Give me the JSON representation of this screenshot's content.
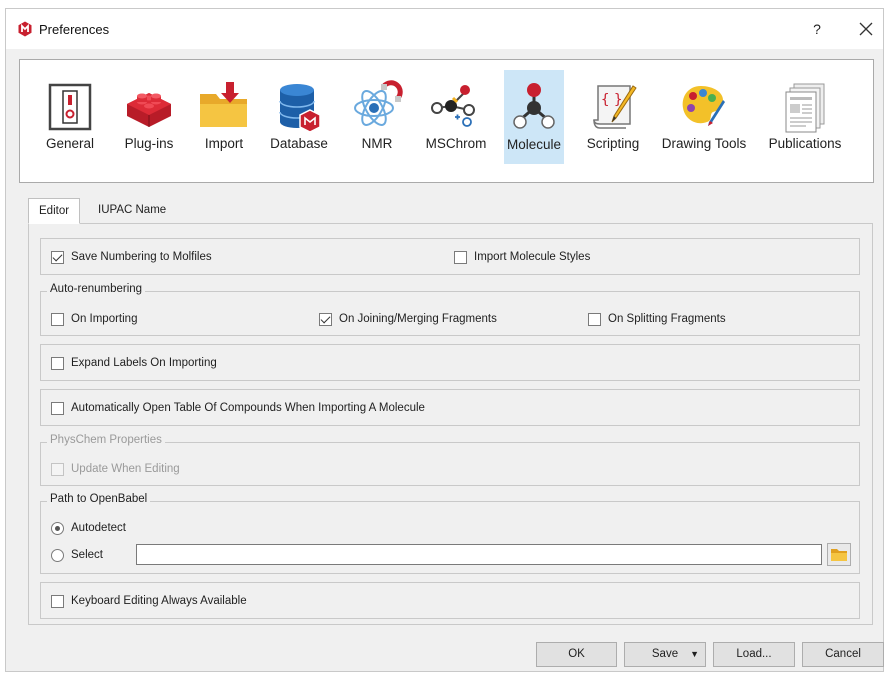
{
  "window": {
    "title": "Preferences",
    "help_label": "?"
  },
  "toolbar": {
    "items": [
      {
        "label": "General",
        "icon": "switch-icon"
      },
      {
        "label": "Plug-ins",
        "icon": "brick-icon"
      },
      {
        "label": "Import",
        "icon": "folder-import-icon"
      },
      {
        "label": "Database",
        "icon": "database-icon"
      },
      {
        "label": "NMR",
        "icon": "nmr-icon"
      },
      {
        "label": "MSChrom",
        "icon": "mschrom-icon"
      },
      {
        "label": "Molecule",
        "icon": "molecule-icon"
      },
      {
        "label": "Scripting",
        "icon": "script-icon"
      },
      {
        "label": "Drawing Tools",
        "icon": "palette-icon"
      },
      {
        "label": "Publications",
        "icon": "publications-icon"
      }
    ],
    "selected": "Molecule"
  },
  "tabs": [
    {
      "label": "Editor"
    },
    {
      "label": "IUPAC Name"
    }
  ],
  "editor": {
    "save_numbering": {
      "label": "Save Numbering to Molfiles",
      "checked": true
    },
    "import_styles": {
      "label": "Import Molecule Styles",
      "checked": false
    },
    "auto_renumbering": {
      "title": "Auto-renumbering",
      "on_importing": {
        "label": "On Importing",
        "checked": false
      },
      "on_joining": {
        "label": "On Joining/Merging Fragments",
        "checked": true
      },
      "on_splitting": {
        "label": "On Splitting Fragments",
        "checked": false
      }
    },
    "expand_labels": {
      "label": "Expand Labels On Importing",
      "checked": false
    },
    "auto_open_table": {
      "label": "Automatically Open Table Of Compounds When Importing A Molecule",
      "checked": false
    },
    "physchem": {
      "title": "PhysChem Properties",
      "update_when_editing": {
        "label": "Update When Editing",
        "checked": false
      }
    },
    "openbabel": {
      "title": "Path to OpenBabel",
      "autodetect": {
        "label": "Autodetect",
        "selected": true
      },
      "select": {
        "label": "Select",
        "selected": false
      },
      "path_value": ""
    },
    "keyboard_editing": {
      "label": "Keyboard Editing Always Available",
      "checked": false
    }
  },
  "buttons": {
    "ok": "OK",
    "save": "Save",
    "load": "Load...",
    "cancel": "Cancel"
  },
  "colors": {
    "selection": "#cde6f7",
    "app_red": "#c8202f"
  }
}
